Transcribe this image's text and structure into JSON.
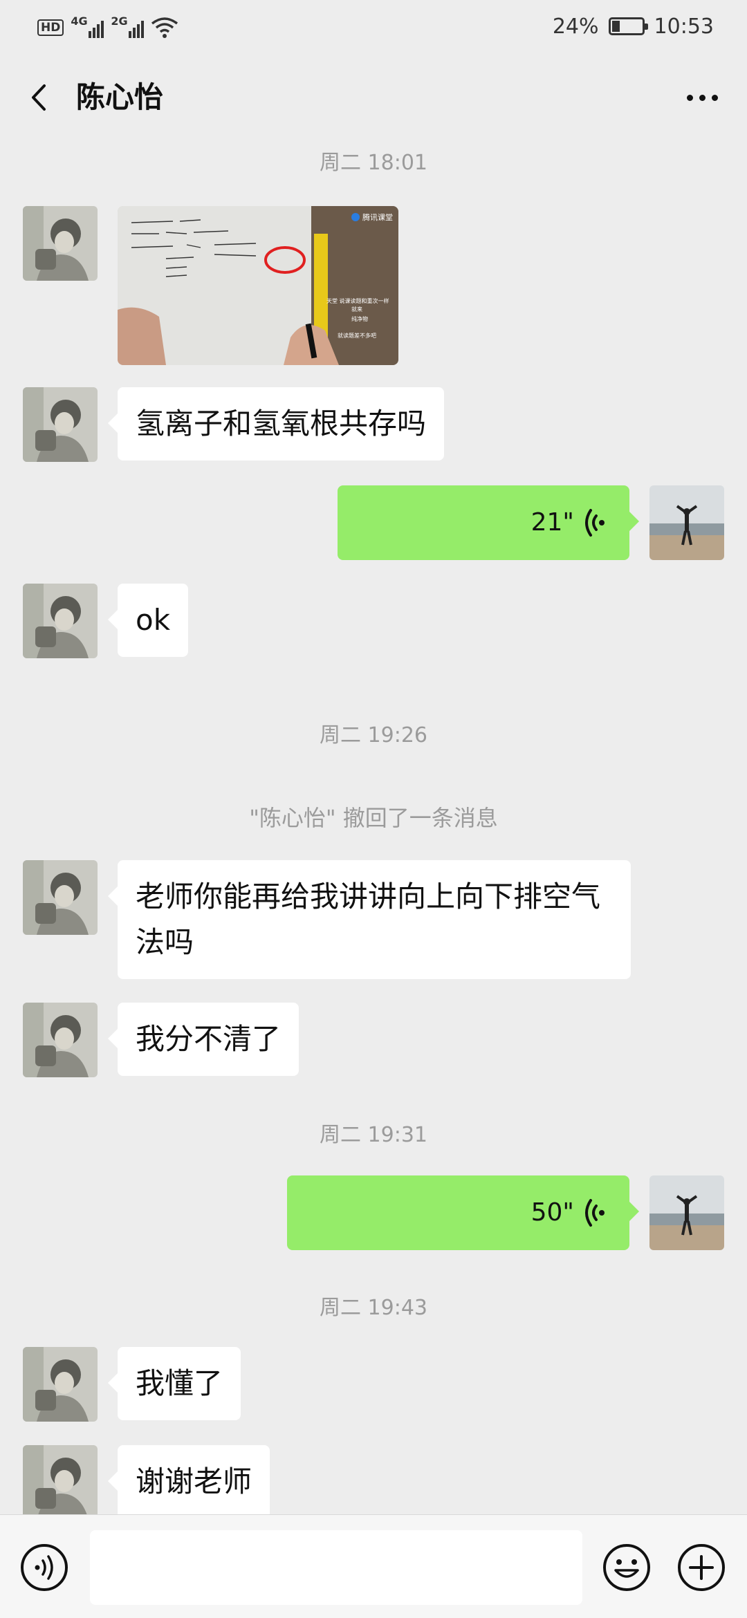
{
  "status_bar": {
    "hd_label": "HD",
    "signal1_label": "4G",
    "signal2_label": "2G",
    "battery_percent": "24%",
    "battery_level": 0.24,
    "time": "10:53"
  },
  "header": {
    "title": "陈心怡"
  },
  "messages": {
    "ts1": "周二 18:01",
    "image_overlay": {
      "app_name": "腾讯课堂",
      "lines": [
        "天堂 说课读题和重次一样",
        "就来",
        "纯净物",
        "就读题差不多吧"
      ]
    },
    "m_hydrogen": "氢离子和氢氧根共存吗",
    "voice1": "21\"",
    "m_ok": "ok",
    "ts2": "周二 19:26",
    "recall_notice": "\"陈心怡\" 撤回了一条消息",
    "m_teacher": "老师你能再给我讲讲向上向下排空气法吗",
    "m_confused": "我分不清了",
    "ts3": "周二 19:31",
    "voice2": "50\"",
    "ts4": "周二 19:43",
    "m_understand": "我懂了",
    "m_thanks": "谢谢老师"
  },
  "icons": {
    "back": "chevron-left-icon",
    "more": "more-dots-icon",
    "voice_play": "voice-wave-icon",
    "voice_input": "voice-input-icon",
    "emoji": "emoji-icon",
    "plus": "plus-icon"
  },
  "colors": {
    "background": "#ededed",
    "sent_bubble": "#95ec69",
    "received_bubble": "#ffffff",
    "timestamp_text": "#9b9b9b"
  }
}
